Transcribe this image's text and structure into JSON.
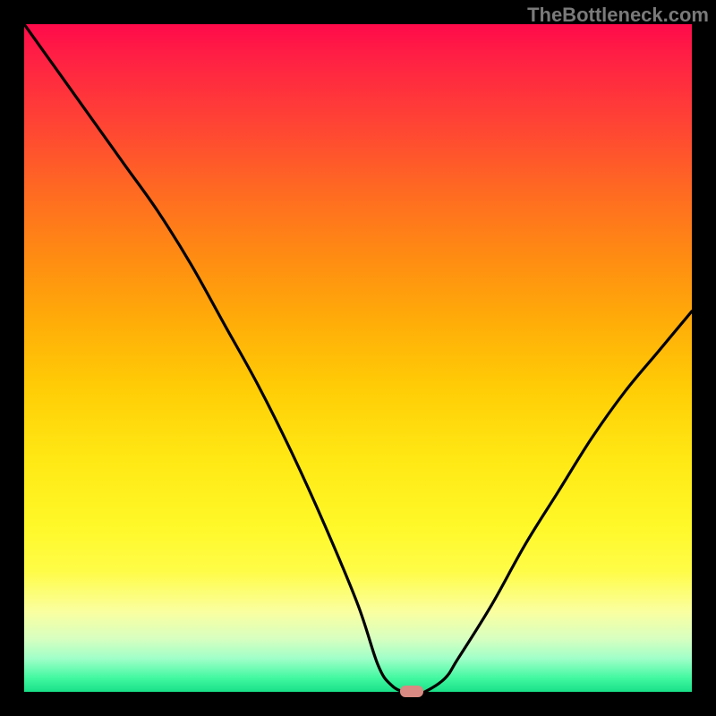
{
  "watermark": "TheBottleneck.com",
  "chart_data": {
    "type": "line",
    "title": "",
    "xlabel": "",
    "ylabel": "",
    "xlim": [
      0,
      100
    ],
    "ylim": [
      0,
      100
    ],
    "x": [
      0,
      5,
      10,
      15,
      20,
      25,
      30,
      35,
      40,
      45,
      50,
      53,
      55,
      57,
      59,
      60,
      63,
      65,
      70,
      75,
      80,
      85,
      90,
      95,
      100
    ],
    "values": [
      100,
      93,
      86,
      79,
      72,
      64,
      55,
      46,
      36,
      25,
      13,
      4,
      1,
      0,
      0,
      0,
      2,
      5,
      13,
      22,
      30,
      38,
      45,
      51,
      57
    ],
    "marker": {
      "x": 58,
      "y": 0
    },
    "background_gradient": {
      "top": "#ff0a4a",
      "mid": "#ffce06",
      "bottom": "#18e088"
    },
    "curve_color": "#000000",
    "marker_color": "#d98a82"
  }
}
